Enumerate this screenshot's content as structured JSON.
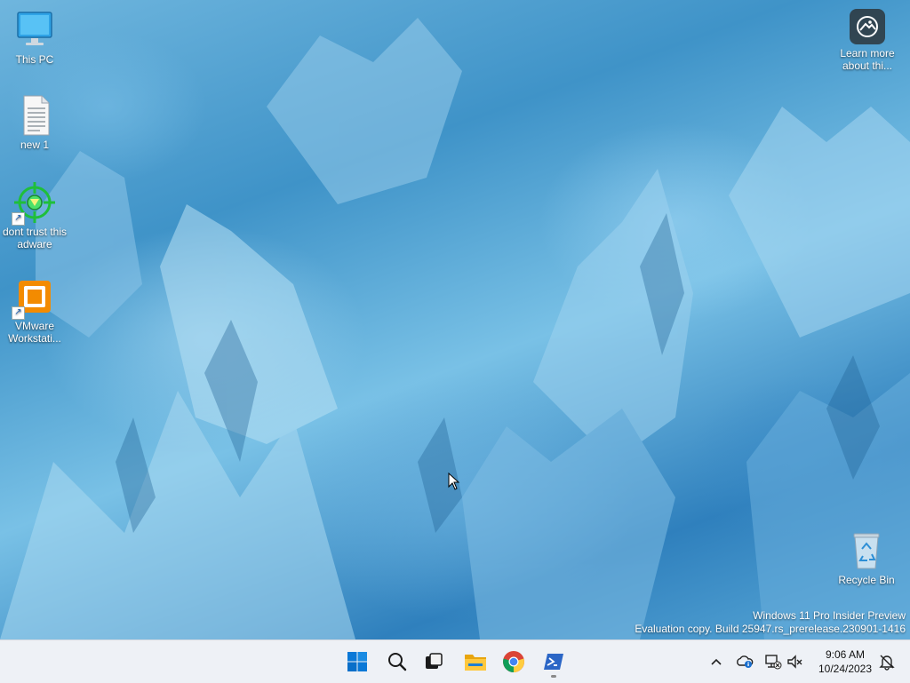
{
  "desktop": {
    "icons": [
      {
        "label": "This PC"
      },
      {
        "label": "new 1"
      },
      {
        "label": "dont trust this adware"
      },
      {
        "label": "VMware Workstati..."
      },
      {
        "label": "Recycle Bin"
      }
    ],
    "learn_more": {
      "label": "Learn more about thi..."
    },
    "watermark": {
      "line1": "Windows 11 Pro Insider Preview",
      "line2": "Evaluation copy. Build 25947.rs_prerelease.230901-1416"
    }
  },
  "taskbar": {
    "apps": [
      {
        "name": "start-button-icon"
      },
      {
        "name": "search-icon"
      },
      {
        "name": "task-view-icon"
      },
      {
        "name": "file-explorer-icon"
      },
      {
        "name": "chrome-icon"
      },
      {
        "name": "powershell-icon"
      }
    ],
    "tray": {
      "time": "9:06 AM",
      "date": "10/24/2023"
    }
  },
  "colors": {
    "accent": "#0067c0",
    "taskbar_bg": "#eef1f6"
  }
}
